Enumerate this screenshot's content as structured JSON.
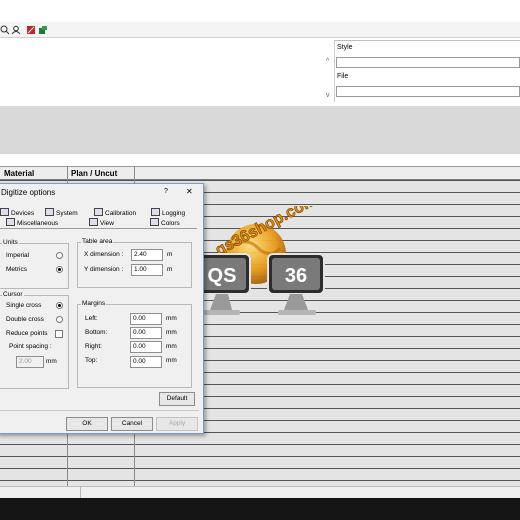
{
  "style_panel": {
    "style_label": "Style",
    "file_label": "File"
  },
  "grid": {
    "col_material": "Material",
    "col_plan_uncut": "Plan / Uncut"
  },
  "dialog": {
    "title": "Digitize options",
    "help_glyph": "?",
    "close_glyph": "✕",
    "tabs_row1": [
      "Devices",
      "System",
      "Calibration",
      "Logging"
    ],
    "tabs_row2": [
      "Miscellaneous",
      "View",
      "Colors"
    ],
    "units": {
      "label": "Units",
      "imperial": "Imperial",
      "metrics": "Metrics",
      "selected": "Metrics"
    },
    "table_area": {
      "label": "Table area",
      "x_label": "X dimension :",
      "x_value": "2.40",
      "y_label": "Y dimension :",
      "y_value": "1.00",
      "unit": "m"
    },
    "cursor": {
      "label": "Cursor",
      "single": "Single cross",
      "double": "Double cross",
      "selected": "Single cross",
      "reduce_points": "Reduce points",
      "point_spacing": "Point spacing :",
      "spacing_value": "2.00",
      "spacing_unit": "mm"
    },
    "margins": {
      "label": "Margins",
      "left": "Left:",
      "left_value": "0.00",
      "bottom": "Bottom:",
      "bottom_value": "0.00",
      "right": "Right:",
      "right_value": "0.00",
      "top": "Top:",
      "top_value": "0.00",
      "unit": "mm"
    },
    "default_button": "Default",
    "ok_button": "OK",
    "cancel_button": "Cancel",
    "apply_button": "Apply"
  },
  "watermark": {
    "site": "qs36shop.com",
    "left_badge": "QS",
    "right_badge": "36"
  }
}
